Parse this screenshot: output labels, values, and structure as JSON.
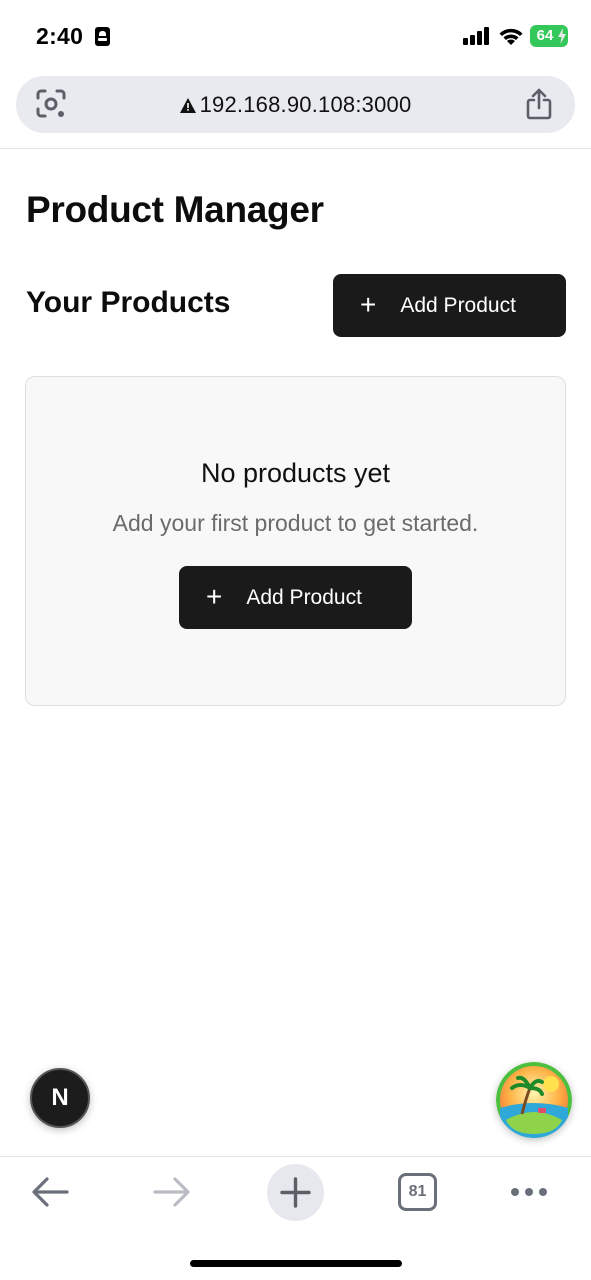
{
  "status_bar": {
    "time": "2:40",
    "battery": "64"
  },
  "browser": {
    "url": "192.168.90.108:3000",
    "tab_count": "81"
  },
  "page": {
    "title": "Product Manager",
    "section_title": "Your Products",
    "add_button_label": "Add Product",
    "empty_state": {
      "title": "No products yet",
      "subtitle": "Add your first product to get started.",
      "button_label": "Add Product"
    }
  },
  "badges": {
    "next_letter": "N"
  },
  "colors": {
    "button_bg": "#1a1a1a",
    "card_bg": "#f8f8f8",
    "battery": "#34c759"
  }
}
